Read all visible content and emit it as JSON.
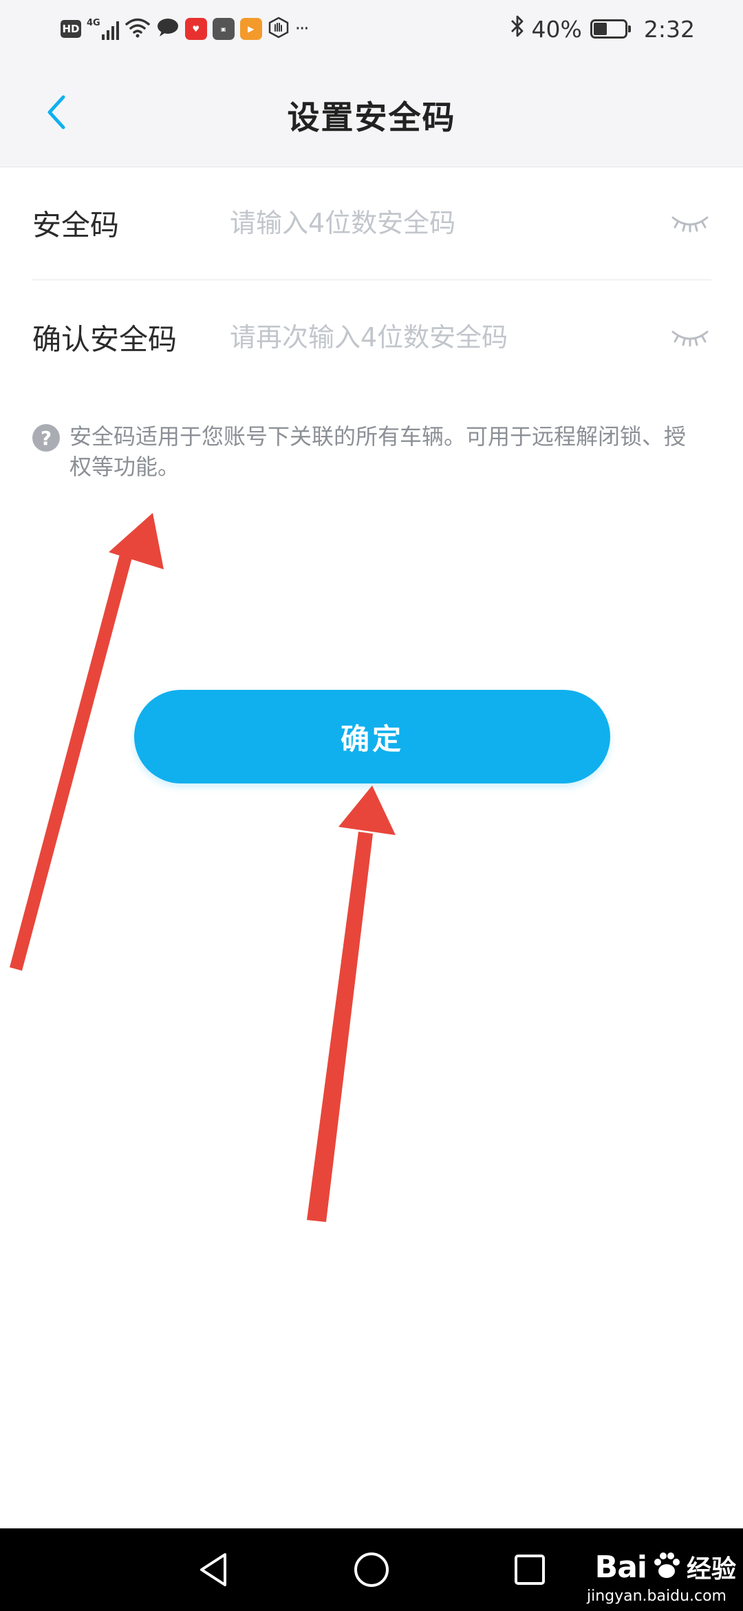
{
  "status_bar": {
    "hd": "HD",
    "network": "4G",
    "bluetooth_icon": "bluetooth-icon",
    "battery": "40%",
    "time": "2:32",
    "more": "···"
  },
  "header": {
    "title": "设置安全码",
    "back_icon": "chevron-left-icon"
  },
  "form": {
    "fields": [
      {
        "label": "安全码",
        "placeholder": "请输入4位数安全码",
        "value": ""
      },
      {
        "label": "确认安全码",
        "placeholder": "请再次输入4位数安全码",
        "value": ""
      }
    ]
  },
  "hint": {
    "text": "安全码适用于您账号下关联的所有车辆。可用于远程解闭锁、授权等功能。"
  },
  "confirm": {
    "label": "确定"
  },
  "watermark": {
    "brand": "Bai",
    "cn": "经验",
    "url": "jingyan.baidu.com"
  },
  "colors": {
    "accent": "#10b0ee",
    "arrow": "#e8463b",
    "header_bg": "#f5f5f7"
  }
}
